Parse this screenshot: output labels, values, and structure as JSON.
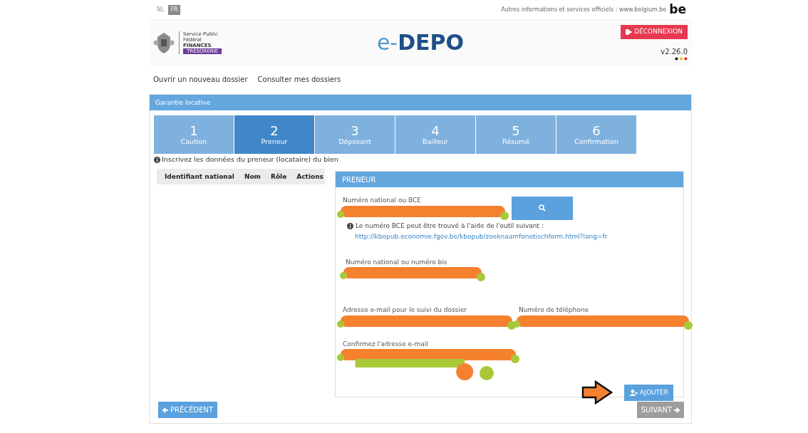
{
  "top_bar": {
    "languages": [
      {
        "label": "NL",
        "selected": false
      },
      {
        "label": "FR",
        "selected": true
      }
    ],
    "info_text": "Autres informations et services officiels : www.belgium.be",
    "be_logo": "be"
  },
  "header": {
    "agency_lines": [
      "Service Public",
      "Fédéral",
      "FINANCES"
    ],
    "agency_tag": "TRÉSORERIE",
    "title_prefix": "e-",
    "title": "DEPO",
    "logout_button": "DÉCONNEXION",
    "version": "v2.26.0"
  },
  "nav": [
    "Ouvrir un nouveau dossier",
    "Consulter mes dossiers"
  ],
  "card": {
    "title": "Garantie locative",
    "steps": [
      {
        "number": "1",
        "label": "Caution",
        "selected": false
      },
      {
        "number": "2",
        "label": "Preneur",
        "selected": true
      },
      {
        "number": "3",
        "label": "Déposant",
        "selected": false
      },
      {
        "number": "4",
        "label": "Bailleur",
        "selected": false
      },
      {
        "number": "5",
        "label": "Résumé",
        "selected": false
      },
      {
        "number": "6",
        "label": "Confirmation",
        "selected": false
      }
    ],
    "instruction": "Inscrivez les données du preneur (locataire) du bien",
    "table": {
      "columns": [
        "Identifiant national",
        "Nom",
        "Rôle",
        "Actions"
      ]
    },
    "panel": {
      "title": "PRENEUR",
      "fields": [
        {
          "label": "Numéro national ou BCE",
          "redacted": true
        },
        {
          "label": "Numéro national ou numéro bis",
          "redacted": true
        },
        {
          "label": "Adresse e-mail pour le suivi du dossier",
          "redacted": true
        },
        {
          "label": "Numéro de téléphone",
          "redacted": true
        },
        {
          "label": "Confirmez l'adresse e-mail",
          "redacted": true
        }
      ],
      "help_text": "Le numéro BCE peut être trouvé à l'aide de l'outil suivant :",
      "help_link": "http://kbopub.economie.fgov.be/kbopub/zoeknaamfonetischform.html?lang=fr",
      "add_button": "AJOUTER"
    },
    "previous_button": {
      "label": "PRÉCÉDENT",
      "disabled": false
    },
    "next_button": {
      "label": "SUIVANT",
      "disabled": true
    }
  }
}
